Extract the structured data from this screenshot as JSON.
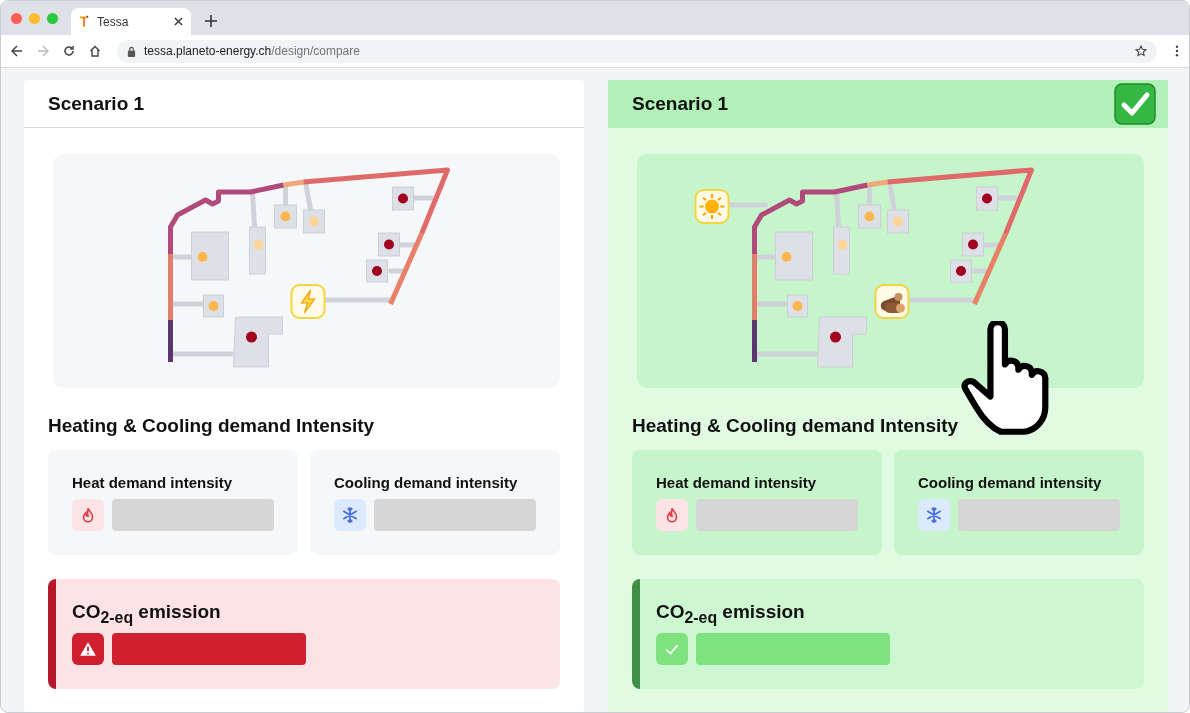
{
  "browser": {
    "tab": {
      "title": "Tessa"
    },
    "url": {
      "host": "tessa.planeto-energy.ch",
      "path": "/design/compare"
    }
  },
  "scenarios": [
    {
      "title": "Scenario 1",
      "selected": false,
      "map": {
        "sources": [
          {
            "kind": "electric"
          }
        ]
      },
      "demand_title": "Heating & Cooling demand Intensity",
      "demands": [
        {
          "kind": "heat",
          "label": "Heat demand intensity"
        },
        {
          "kind": "cooling",
          "label": "Cooling demand intensity"
        }
      ],
      "emission": {
        "label": "CO$_{2-eq}$ emission",
        "alert": true
      }
    },
    {
      "title": "Scenario 1",
      "selected": true,
      "map": {
        "sources": [
          {
            "kind": "solar"
          },
          {
            "kind": "wood"
          }
        ]
      },
      "demand_title": "Heating & Cooling demand Intensity",
      "demands": [
        {
          "kind": "heat",
          "label": "Heat demand intensity"
        },
        {
          "kind": "cooling",
          "label": "Cooling demand intensity"
        }
      ],
      "emission": {
        "label": "CO$_{2-eq}$ emission",
        "alert": false
      }
    }
  ]
}
